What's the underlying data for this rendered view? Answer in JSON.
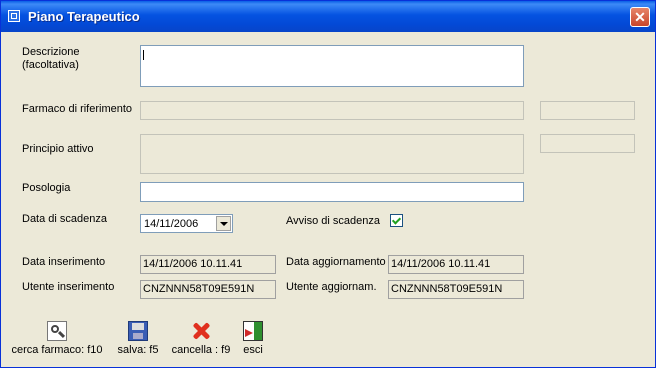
{
  "window": {
    "title": "Piano Terapeutico",
    "close_icon": "close-icon"
  },
  "form": {
    "descrizione_label": "Descrizione\n(facoltativa)",
    "descrizione_value": "",
    "farmaco_label": "Farmaco di riferimento",
    "farmaco_value": "",
    "farmaco_code": "",
    "principio_label": "Principio attivo",
    "principio_value": "",
    "principio_code": "",
    "posologia_label": "Posologia",
    "posologia_value": "",
    "scadenza_label": "Data di scadenza",
    "scadenza_value": "14/11/2006",
    "avviso_label": "Avviso di scadenza",
    "avviso_checked": true,
    "inserimento_label": "Data inserimento",
    "inserimento_value": "14/11/2006 10.11.41",
    "aggiornamento_label": "Data aggiornamento",
    "aggiornamento_value": "14/11/2006 10.11.41",
    "utente_ins_label": "Utente inserimento",
    "utente_ins_value": "CNZNNN58T09E591N",
    "utente_agg_label": "Utente aggiornam.",
    "utente_agg_value": "CNZNNN58T09E591N"
  },
  "toolbar": {
    "cerca": {
      "label": "cerca farmaco: f10",
      "icon": "magnifier-icon"
    },
    "salva": {
      "label": "salva: f5",
      "icon": "floppy-disk-icon"
    },
    "cancella": {
      "label": "cancella : f9",
      "icon": "red-x-icon"
    },
    "esci": {
      "label": "esci",
      "icon": "exit-door-icon"
    }
  }
}
